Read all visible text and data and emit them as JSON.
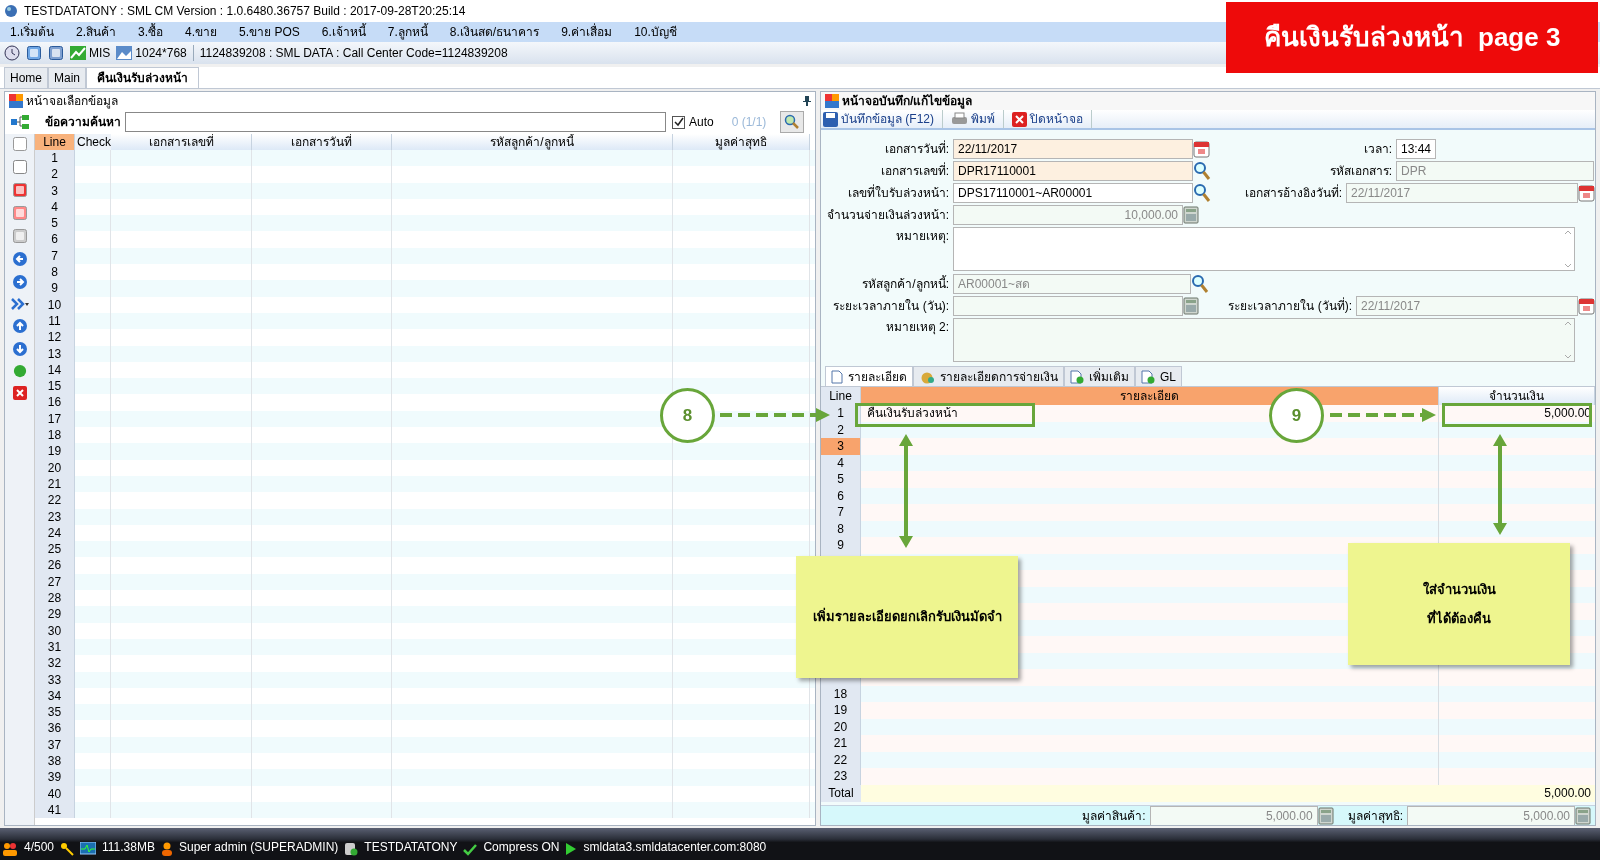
{
  "window": {
    "title": "TESTDATATONY : SML CM Version : 1.0.6480.36757  Build : 2017-09-28T20:25:14"
  },
  "menu": [
    "1.เริ่มต้น",
    "2.สินค้า",
    "3.ซื้อ",
    "4.ขาย",
    "5.ขาย POS",
    "6.เจ้าหนี้",
    "7.ลูกหนี้",
    "8.เงินสด/ธนาคาร",
    "9.ค่าเสื่อม",
    "10.บัญชี"
  ],
  "toolbar": {
    "mis": "MIS",
    "resolution": "1024*768",
    "info": "1124839208 : SML DATA : Call Center Code=1124839208"
  },
  "tabs": [
    {
      "label": "Home",
      "selected": false
    },
    {
      "label": "Main",
      "selected": false
    },
    {
      "label": "คืนเงินรับล่วงหน้า",
      "selected": true
    }
  ],
  "left_panel": {
    "title": "หน้าจอเลือกข้อมูล",
    "search_label": "ข้อความค้นหา",
    "auto": {
      "label": "Auto",
      "checked": true
    },
    "count": "0 (1/1)",
    "columns": [
      "Line",
      "Check",
      "เอกสารเลขที่",
      "เอกสารวันที่",
      "รหัสลูกค้า/ลูกหนี้",
      "มูลค่าสุทธิ"
    ],
    "lines": [
      "1",
      "2",
      "3",
      "4",
      "5",
      "6",
      "7",
      "8",
      "9",
      "10",
      "11",
      "12",
      "13",
      "14",
      "15",
      "16",
      "17",
      "18",
      "19",
      "20",
      "21",
      "22",
      "23",
      "24",
      "25",
      "26",
      "27",
      "28",
      "29",
      "30",
      "31",
      "32",
      "33",
      "34",
      "35",
      "36",
      "37",
      "38",
      "39",
      "40",
      "41"
    ]
  },
  "right_panel": {
    "title": "หน้าจอบันทึก/แก้ไขข้อมูล",
    "actions": [
      {
        "label": "บันทึกข้อมูล (F12)",
        "kind": "save"
      },
      {
        "label": "พิมพ์",
        "kind": "print"
      },
      {
        "label": "ปิดหน้าจอ",
        "kind": "close"
      }
    ],
    "doc_date": {
      "label": "เอกสารวันที่:",
      "value": "22/11/2017",
      "required": true,
      "disabled": false
    },
    "time": {
      "label": "เวลา:",
      "value": "13:44",
      "required": false,
      "disabled": false
    },
    "doc_no": {
      "label": "เอกสารเลขที่:",
      "value": "DPR17110001",
      "required": true,
      "disabled": false
    },
    "doc_code": {
      "label": "รหัสเอกสาร:",
      "value": "DPR",
      "required": false,
      "disabled": true
    },
    "advance_no": {
      "label": "เลขที่ใบรับล่วงหน้า:",
      "value": "DPS17110001~AR00001",
      "required": false,
      "disabled": false
    },
    "ref_date": {
      "label": "เอกสารอ้างอิงวันที่:",
      "value": "22/11/2017",
      "required": false,
      "disabled": true
    },
    "advance_amount": {
      "label": "จำนวนจ่ายเงินล่วงหน้า:",
      "value": "10,000.00",
      "required": false,
      "disabled": true
    },
    "note": {
      "label": "หมายเหตุ:",
      "disabled": false
    },
    "customer": {
      "label": "รหัสลูกค้า/ลูกหนี้:",
      "value": "AR00001~สด",
      "required": false,
      "disabled": true
    },
    "period_days": {
      "label": "ระยะเวลาภายใน (วัน):",
      "required": false,
      "disabled": true
    },
    "period_date": {
      "label": "ระยะเวลาภายใน (วันที่):",
      "value": "22/11/2017",
      "required": false,
      "disabled": true
    },
    "note2": {
      "label": "หมายเหตุ 2:",
      "disabled": true
    },
    "detail_tabs": [
      {
        "label": "รายละเอียด",
        "kind": "page",
        "selected": true
      },
      {
        "label": "รายละเอียดการจ่ายเงิน",
        "kind": "money",
        "selected": false
      },
      {
        "label": "เพิ่มเติม",
        "kind": "add",
        "selected": false
      },
      {
        "label": "GL",
        "kind": "add",
        "selected": false
      }
    ],
    "columns": [
      "Line",
      "รายละเอียด",
      "จำนวนเงิน"
    ],
    "rows_top": [
      {
        "line": "1",
        "detail": "คืนเงินรับล่วงหน้า",
        "amount": "5,000.00",
        "selected": false
      },
      {
        "line": "2",
        "selected": false
      },
      {
        "line": "3",
        "selected": true
      },
      {
        "line": "4",
        "selected": false
      },
      {
        "line": "5",
        "selected": false
      },
      {
        "line": "6",
        "selected": false
      },
      {
        "line": "7",
        "selected": false
      },
      {
        "line": "8",
        "selected": false
      },
      {
        "line": "9",
        "selected": false
      }
    ],
    "rows_bottom": [
      {
        "line": "18",
        "selected": false
      },
      {
        "line": "19",
        "selected": false
      },
      {
        "line": "20",
        "selected": false
      },
      {
        "line": "21",
        "selected": false
      },
      {
        "line": "22",
        "selected": false
      },
      {
        "line": "23",
        "selected": false
      }
    ],
    "total": {
      "label": "Total",
      "amount": "5,000.00"
    },
    "footer": [
      {
        "label": "มูลค่าสินค้า:",
        "value": "5,000.00"
      },
      {
        "label": "มูลค่าสุทธิ:",
        "value": "5,000.00"
      }
    ]
  },
  "status_bar": {
    "users": "4/500",
    "memory": "111.38MB",
    "user": "Super admin (SUPERADMIN)",
    "database": "TESTDATATONY",
    "compress": "Compress ON",
    "server": "smldata3.smldatacenter.com:8080"
  },
  "annotations": {
    "banner": "คืนเงินรับล่วงหน้า  page 3",
    "steps": [
      "8",
      "9"
    ],
    "notes": [
      {
        "lines": [
          "เพิ่มรายละเอียดยกเลิกรับเงินมัดจำ"
        ]
      },
      {
        "lines": [
          "ใส่จำนวนเงิน",
          "ที่ได้ต้องคืน"
        ]
      }
    ]
  }
}
